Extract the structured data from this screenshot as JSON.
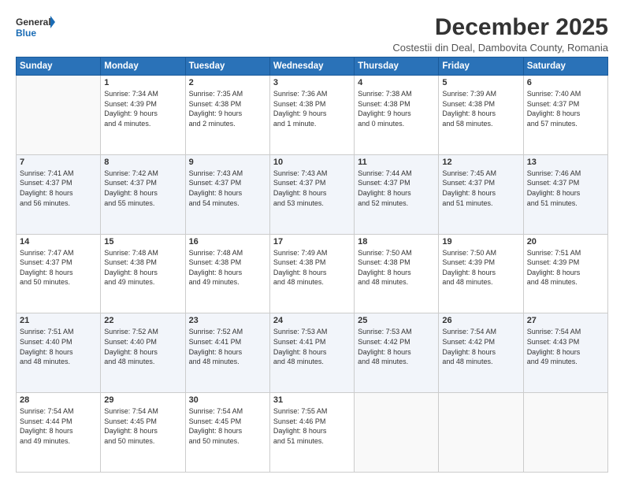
{
  "logo": {
    "line1": "General",
    "line2": "Blue"
  },
  "title": "December 2025",
  "subtitle": "Costestii din Deal, Dambovita County, Romania",
  "days_header": [
    "Sunday",
    "Monday",
    "Tuesday",
    "Wednesday",
    "Thursday",
    "Friday",
    "Saturday"
  ],
  "weeks": [
    [
      {
        "num": "",
        "content": ""
      },
      {
        "num": "1",
        "content": "Sunrise: 7:34 AM\nSunset: 4:39 PM\nDaylight: 9 hours\nand 4 minutes."
      },
      {
        "num": "2",
        "content": "Sunrise: 7:35 AM\nSunset: 4:38 PM\nDaylight: 9 hours\nand 2 minutes."
      },
      {
        "num": "3",
        "content": "Sunrise: 7:36 AM\nSunset: 4:38 PM\nDaylight: 9 hours\nand 1 minute."
      },
      {
        "num": "4",
        "content": "Sunrise: 7:38 AM\nSunset: 4:38 PM\nDaylight: 9 hours\nand 0 minutes."
      },
      {
        "num": "5",
        "content": "Sunrise: 7:39 AM\nSunset: 4:38 PM\nDaylight: 8 hours\nand 58 minutes."
      },
      {
        "num": "6",
        "content": "Sunrise: 7:40 AM\nSunset: 4:37 PM\nDaylight: 8 hours\nand 57 minutes."
      }
    ],
    [
      {
        "num": "7",
        "content": "Sunrise: 7:41 AM\nSunset: 4:37 PM\nDaylight: 8 hours\nand 56 minutes."
      },
      {
        "num": "8",
        "content": "Sunrise: 7:42 AM\nSunset: 4:37 PM\nDaylight: 8 hours\nand 55 minutes."
      },
      {
        "num": "9",
        "content": "Sunrise: 7:43 AM\nSunset: 4:37 PM\nDaylight: 8 hours\nand 54 minutes."
      },
      {
        "num": "10",
        "content": "Sunrise: 7:43 AM\nSunset: 4:37 PM\nDaylight: 8 hours\nand 53 minutes."
      },
      {
        "num": "11",
        "content": "Sunrise: 7:44 AM\nSunset: 4:37 PM\nDaylight: 8 hours\nand 52 minutes."
      },
      {
        "num": "12",
        "content": "Sunrise: 7:45 AM\nSunset: 4:37 PM\nDaylight: 8 hours\nand 51 minutes."
      },
      {
        "num": "13",
        "content": "Sunrise: 7:46 AM\nSunset: 4:37 PM\nDaylight: 8 hours\nand 51 minutes."
      }
    ],
    [
      {
        "num": "14",
        "content": "Sunrise: 7:47 AM\nSunset: 4:37 PM\nDaylight: 8 hours\nand 50 minutes."
      },
      {
        "num": "15",
        "content": "Sunrise: 7:48 AM\nSunset: 4:38 PM\nDaylight: 8 hours\nand 49 minutes."
      },
      {
        "num": "16",
        "content": "Sunrise: 7:48 AM\nSunset: 4:38 PM\nDaylight: 8 hours\nand 49 minutes."
      },
      {
        "num": "17",
        "content": "Sunrise: 7:49 AM\nSunset: 4:38 PM\nDaylight: 8 hours\nand 48 minutes."
      },
      {
        "num": "18",
        "content": "Sunrise: 7:50 AM\nSunset: 4:38 PM\nDaylight: 8 hours\nand 48 minutes."
      },
      {
        "num": "19",
        "content": "Sunrise: 7:50 AM\nSunset: 4:39 PM\nDaylight: 8 hours\nand 48 minutes."
      },
      {
        "num": "20",
        "content": "Sunrise: 7:51 AM\nSunset: 4:39 PM\nDaylight: 8 hours\nand 48 minutes."
      }
    ],
    [
      {
        "num": "21",
        "content": "Sunrise: 7:51 AM\nSunset: 4:40 PM\nDaylight: 8 hours\nand 48 minutes."
      },
      {
        "num": "22",
        "content": "Sunrise: 7:52 AM\nSunset: 4:40 PM\nDaylight: 8 hours\nand 48 minutes."
      },
      {
        "num": "23",
        "content": "Sunrise: 7:52 AM\nSunset: 4:41 PM\nDaylight: 8 hours\nand 48 minutes."
      },
      {
        "num": "24",
        "content": "Sunrise: 7:53 AM\nSunset: 4:41 PM\nDaylight: 8 hours\nand 48 minutes."
      },
      {
        "num": "25",
        "content": "Sunrise: 7:53 AM\nSunset: 4:42 PM\nDaylight: 8 hours\nand 48 minutes."
      },
      {
        "num": "26",
        "content": "Sunrise: 7:54 AM\nSunset: 4:42 PM\nDaylight: 8 hours\nand 48 minutes."
      },
      {
        "num": "27",
        "content": "Sunrise: 7:54 AM\nSunset: 4:43 PM\nDaylight: 8 hours\nand 49 minutes."
      }
    ],
    [
      {
        "num": "28",
        "content": "Sunrise: 7:54 AM\nSunset: 4:44 PM\nDaylight: 8 hours\nand 49 minutes."
      },
      {
        "num": "29",
        "content": "Sunrise: 7:54 AM\nSunset: 4:45 PM\nDaylight: 8 hours\nand 50 minutes."
      },
      {
        "num": "30",
        "content": "Sunrise: 7:54 AM\nSunset: 4:45 PM\nDaylight: 8 hours\nand 50 minutes."
      },
      {
        "num": "31",
        "content": "Sunrise: 7:55 AM\nSunset: 4:46 PM\nDaylight: 8 hours\nand 51 minutes."
      },
      {
        "num": "",
        "content": ""
      },
      {
        "num": "",
        "content": ""
      },
      {
        "num": "",
        "content": ""
      }
    ]
  ]
}
